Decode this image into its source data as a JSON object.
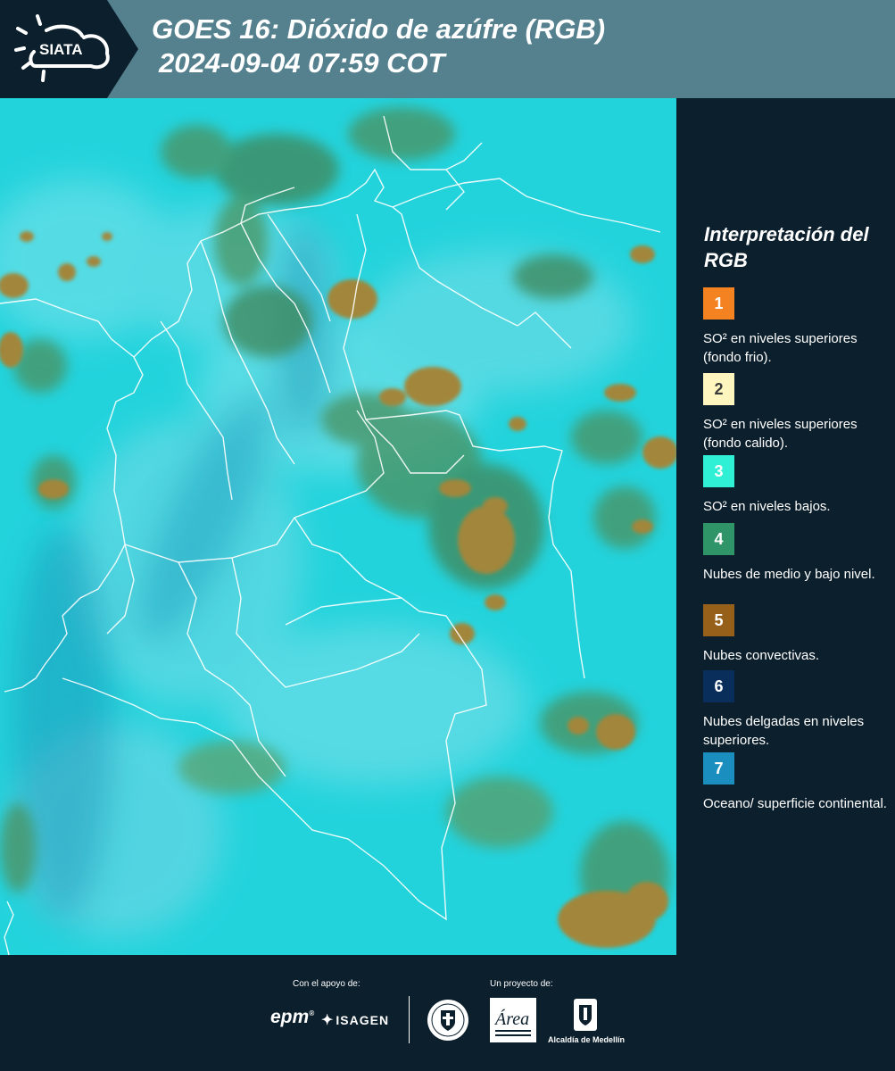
{
  "header": {
    "logo_text": "SIATA",
    "title_line_1": "GOES 16: Dióxido de azúfre (RGB)",
    "title_line_2": "2024-09-04 07:59 COT"
  },
  "colors": {
    "header_bg": "#55818f",
    "panel_bg": "#0c1f2c",
    "map_base": "#23d3dc",
    "low_cloud": "#3f8a5e",
    "convective": "#a2863a"
  },
  "legend": {
    "title": "Interpretación del RGB",
    "items": [
      {
        "number": "1",
        "color": "#f58220",
        "number_color": "#ffffff",
        "text": "SO² en niveles superiores (fondo frio)."
      },
      {
        "number": "2",
        "color": "#fef5bf",
        "number_color": "#3b3b3b",
        "text": "SO² en niveles superiores (fondo calido)."
      },
      {
        "number": "3",
        "color": "#2ff0d5",
        "number_color": "#ffffff",
        "text": "SO² en niveles bajos."
      },
      {
        "number": "4",
        "color": "#2f9468",
        "number_color": "#ffffff",
        "text": "Nubes de medio y bajo nivel."
      },
      {
        "number": "5",
        "color": "#97601a",
        "number_color": "#ffffff",
        "text": "Nubes convectivas."
      },
      {
        "number": "6",
        "color": "#0a2e5b",
        "number_color": "#ffffff",
        "text": "Nubes delgadas en niveles superiores."
      },
      {
        "number": "7",
        "color": "#1a8fbf",
        "number_color": "#ffffff",
        "text": "Oceano/ superficie continental."
      }
    ]
  },
  "footer": {
    "support_caption": "Con el apoyo de:",
    "project_caption": "Un proyecto de:",
    "sponsors": [
      "epm",
      "ISAGEN"
    ],
    "partners": [
      "Medellín",
      "Área Metropolitana Valle de Aburrá",
      "Alcaldía de Medellín"
    ],
    "alcaldia_label": "Alcaldía de Medellín"
  }
}
